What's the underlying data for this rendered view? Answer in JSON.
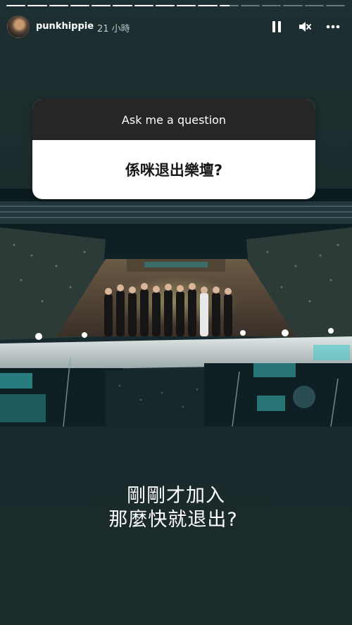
{
  "progress": {
    "segments": [
      1,
      1,
      1,
      1,
      1,
      1,
      1,
      1,
      1,
      1,
      0.55,
      0,
      0,
      0,
      0,
      0
    ]
  },
  "header": {
    "username": "punkhippie",
    "time": "21 小時",
    "icons": [
      "pause-icon",
      "mute-icon",
      "more-icon"
    ]
  },
  "question_sticker": {
    "prompt": "Ask me a question",
    "question": "係咪退出樂壇?"
  },
  "caption": {
    "line1": "剛剛才加入",
    "line2": "那麼快就退出?"
  },
  "colors": {
    "background": "#1b2b2c",
    "sticker_header": "#262626",
    "accent_cyan": "#3fc9c9"
  }
}
